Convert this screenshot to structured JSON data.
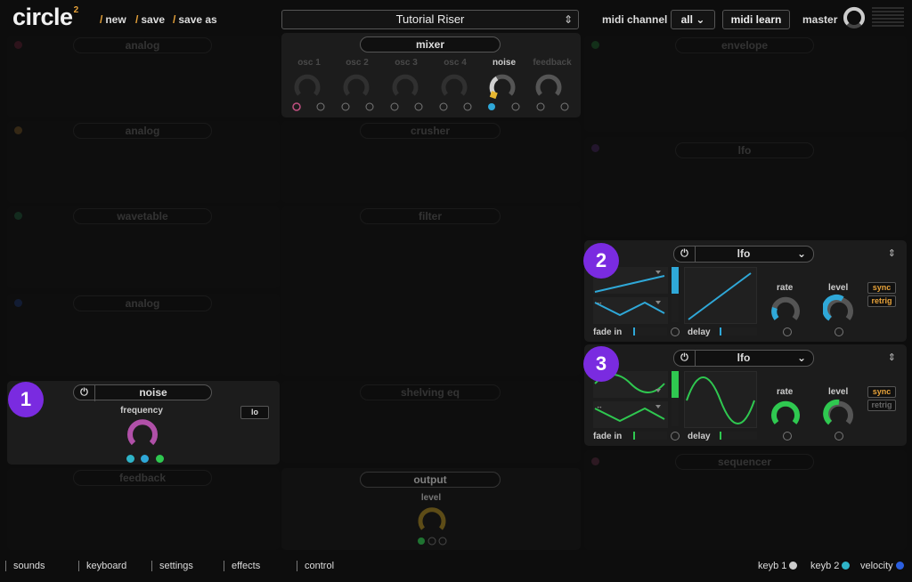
{
  "app": {
    "logo": "circle",
    "logo_sup": "2"
  },
  "top": {
    "nav": [
      "new",
      "save",
      "save as"
    ],
    "preset_name": "Tutorial Riser",
    "midi_channel_label": "midi channel",
    "midi_channel_value": "all",
    "midi_learn": "midi learn",
    "master_label": "master"
  },
  "left": {
    "slots": [
      {
        "name": "analog",
        "color": "#c0305a"
      },
      {
        "name": "analog",
        "color": "#e8a33a"
      },
      {
        "name": "wavetable",
        "color": "#2fb46e"
      },
      {
        "name": "analog",
        "color": "#2b5fe0"
      },
      {
        "name": "feedback",
        "color": "#444444"
      }
    ],
    "noise": {
      "title": "noise",
      "knob_label": "frequency",
      "button": "lo"
    }
  },
  "center": {
    "mixer": {
      "title": "mixer",
      "channels": [
        "osc 1",
        "osc 2",
        "osc 3",
        "osc 4",
        "noise",
        "feedback"
      ]
    },
    "effects": [
      "crusher",
      "filter",
      "shelving eq"
    ],
    "output": {
      "title": "output",
      "knob_label": "level"
    }
  },
  "right": {
    "envelope": "envelope",
    "lfo_dim": "lfo",
    "lfo2": {
      "title": "lfo",
      "fade_in": "fade in",
      "delay": "delay",
      "rate": "rate",
      "level": "level",
      "sync": "sync",
      "retrig": "retrig"
    },
    "lfo3": {
      "title": "lfo",
      "fade_in": "fade in",
      "delay": "delay",
      "rate": "rate",
      "level": "level",
      "sync": "sync",
      "retrig": "retrig"
    },
    "sequencer": "sequencer"
  },
  "badges": [
    "1",
    "2",
    "3"
  ],
  "bottom": {
    "tabs": [
      "sounds",
      "keyboard",
      "settings",
      "effects",
      "control"
    ],
    "legend": [
      {
        "label": "keyb 1",
        "color": "#cccccc"
      },
      {
        "label": "keyb 2",
        "color": "#2fb4c8"
      },
      {
        "label": "velocity",
        "color": "#2b5fe0"
      }
    ]
  },
  "colors": {
    "accent": "#e8a33a",
    "lfo_blue": "#2fa8d8",
    "lfo_green": "#2fc850",
    "noise_knob": "#b050a8",
    "badge": "#7a2be0"
  }
}
